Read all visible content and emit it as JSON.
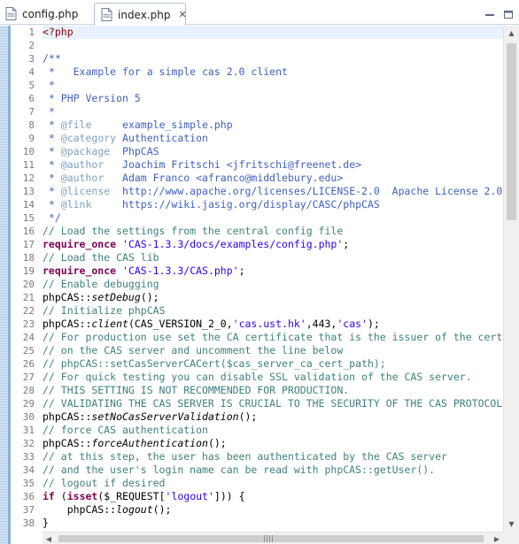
{
  "tabs": [
    {
      "label": "config.php",
      "active": false,
      "icon": "php-file-icon"
    },
    {
      "label": "index.php",
      "active": true,
      "icon": "php-file-icon",
      "close_glyph": "✕"
    }
  ],
  "window_controls": {
    "minimize_icon": "minimize-icon",
    "maximize_icon": "maximize-icon"
  },
  "colors": {
    "keyword": "#7f0055",
    "string": "#2a00ff",
    "comment": "#3f7f7f",
    "doc_comment": "#3f5fbf",
    "current_line": "#e8f2fe"
  },
  "editor": {
    "current_line": 1,
    "lines": [
      {
        "n": "1",
        "tokens": [
          {
            "t": "phptag",
            "v": "<?php"
          }
        ]
      },
      {
        "n": "2",
        "tokens": []
      },
      {
        "n": "3",
        "tokens": [
          {
            "t": "doccomment",
            "v": "/**"
          }
        ]
      },
      {
        "n": "4",
        "tokens": [
          {
            "t": "doccomment",
            "v": " *   Example for a simple cas 2.0 client"
          }
        ]
      },
      {
        "n": "5",
        "tokens": [
          {
            "t": "doccomment",
            "v": " *"
          }
        ]
      },
      {
        "n": "6",
        "tokens": [
          {
            "t": "doccomment",
            "v": " * PHP Version 5"
          }
        ]
      },
      {
        "n": "7",
        "tokens": [
          {
            "t": "doccomment",
            "v": " *"
          }
        ]
      },
      {
        "n": "8",
        "tokens": [
          {
            "t": "doccomment",
            "v": " * "
          },
          {
            "t": "tag",
            "v": "@file"
          },
          {
            "t": "doccomment",
            "v": "     example_simple.php"
          }
        ]
      },
      {
        "n": "9",
        "tokens": [
          {
            "t": "doccomment",
            "v": " * "
          },
          {
            "t": "tag",
            "v": "@category"
          },
          {
            "t": "doccomment",
            "v": " Authentication"
          }
        ]
      },
      {
        "n": "10",
        "tokens": [
          {
            "t": "doccomment",
            "v": " * "
          },
          {
            "t": "tag",
            "v": "@package"
          },
          {
            "t": "doccomment",
            "v": "  PhpCAS"
          }
        ]
      },
      {
        "n": "11",
        "tokens": [
          {
            "t": "doccomment",
            "v": " * "
          },
          {
            "t": "tag",
            "v": "@author"
          },
          {
            "t": "doccomment",
            "v": "   Joachim Fritschi <jfritschi@freenet.de>"
          }
        ]
      },
      {
        "n": "12",
        "tokens": [
          {
            "t": "doccomment",
            "v": " * "
          },
          {
            "t": "tag",
            "v": "@author"
          },
          {
            "t": "doccomment",
            "v": "   Adam Franco <afranco@middlebury.edu>"
          }
        ]
      },
      {
        "n": "13",
        "tokens": [
          {
            "t": "doccomment",
            "v": " * "
          },
          {
            "t": "tag",
            "v": "@license"
          },
          {
            "t": "doccomment",
            "v": "  http://www.apache.org/licenses/LICENSE-2.0  Apache License 2.0"
          }
        ]
      },
      {
        "n": "14",
        "tokens": [
          {
            "t": "doccomment",
            "v": " * "
          },
          {
            "t": "tag",
            "v": "@link"
          },
          {
            "t": "doccomment",
            "v": "     https://wiki.jasig.org/display/CASC/phpCAS"
          }
        ]
      },
      {
        "n": "15",
        "tokens": [
          {
            "t": "doccomment",
            "v": " */"
          }
        ]
      },
      {
        "n": "16",
        "tokens": [
          {
            "t": "comment",
            "v": "// Load the settings from the central config file"
          }
        ]
      },
      {
        "n": "17",
        "tokens": [
          {
            "t": "keyword",
            "v": "require_once"
          },
          {
            "t": "plain",
            "v": " "
          },
          {
            "t": "string",
            "v": "'CAS-1.3.3/docs/examples/config.php'"
          },
          {
            "t": "plain",
            "v": ";"
          }
        ]
      },
      {
        "n": "18",
        "tokens": [
          {
            "t": "comment",
            "v": "// Load the CAS lib"
          }
        ]
      },
      {
        "n": "19",
        "tokens": [
          {
            "t": "keyword",
            "v": "require_once"
          },
          {
            "t": "plain",
            "v": " "
          },
          {
            "t": "string",
            "v": "'CAS-1.3.3/CAS.php'"
          },
          {
            "t": "plain",
            "v": ";"
          }
        ]
      },
      {
        "n": "20",
        "tokens": [
          {
            "t": "comment",
            "v": "// Enable debugging"
          }
        ]
      },
      {
        "n": "21",
        "tokens": [
          {
            "t": "plain",
            "v": "phpCAS::"
          },
          {
            "t": "method",
            "v": "setDebug"
          },
          {
            "t": "plain",
            "v": "();"
          }
        ]
      },
      {
        "n": "22",
        "tokens": [
          {
            "t": "comment",
            "v": "// Initialize phpCAS"
          }
        ]
      },
      {
        "n": "23",
        "tokens": [
          {
            "t": "plain",
            "v": "phpCAS::"
          },
          {
            "t": "method",
            "v": "client"
          },
          {
            "t": "plain",
            "v": "(CAS_VERSION_2_0,"
          },
          {
            "t": "string",
            "v": "'cas.ust.hk'"
          },
          {
            "t": "plain",
            "v": ",443,"
          },
          {
            "t": "string",
            "v": "'cas'"
          },
          {
            "t": "plain",
            "v": ");"
          }
        ]
      },
      {
        "n": "24",
        "tokens": [
          {
            "t": "comment",
            "v": "// For production use set the CA certificate that is the issuer of the cert"
          }
        ]
      },
      {
        "n": "25",
        "tokens": [
          {
            "t": "comment",
            "v": "// on the CAS server and uncomment the line below"
          }
        ]
      },
      {
        "n": "26",
        "tokens": [
          {
            "t": "comment",
            "v": "// phpCAS::setCasServerCACert($cas_server_ca_cert_path);"
          }
        ]
      },
      {
        "n": "27",
        "tokens": [
          {
            "t": "comment",
            "v": "// For quick testing you can disable SSL validation of the CAS server."
          }
        ]
      },
      {
        "n": "28",
        "tokens": [
          {
            "t": "comment",
            "v": "// THIS SETTING IS NOT RECOMMENDED FOR PRODUCTION."
          }
        ]
      },
      {
        "n": "29",
        "tokens": [
          {
            "t": "comment",
            "v": "// VALIDATING THE CAS SERVER IS CRUCIAL TO THE SECURITY OF THE CAS PROTOCOL"
          }
        ]
      },
      {
        "n": "30",
        "tokens": [
          {
            "t": "plain",
            "v": "phpCAS::"
          },
          {
            "t": "method",
            "v": "setNoCasServerValidation"
          },
          {
            "t": "plain",
            "v": "();"
          }
        ]
      },
      {
        "n": "31",
        "tokens": [
          {
            "t": "comment",
            "v": "// force CAS authentication"
          }
        ]
      },
      {
        "n": "32",
        "tokens": [
          {
            "t": "plain",
            "v": "phpCAS::"
          },
          {
            "t": "method",
            "v": "forceAuthentication"
          },
          {
            "t": "plain",
            "v": "();"
          }
        ]
      },
      {
        "n": "33",
        "tokens": [
          {
            "t": "comment",
            "v": "// at this step, the user has been authenticated by the CAS server"
          }
        ]
      },
      {
        "n": "34",
        "tokens": [
          {
            "t": "comment",
            "v": "// and the user's login name can be read with phpCAS::getUser()."
          }
        ]
      },
      {
        "n": "35",
        "tokens": [
          {
            "t": "comment",
            "v": "// logout if desired"
          }
        ]
      },
      {
        "n": "36",
        "tokens": [
          {
            "t": "keyword",
            "v": "if"
          },
          {
            "t": "plain",
            "v": " ("
          },
          {
            "t": "keyword",
            "v": "isset"
          },
          {
            "t": "plain",
            "v": "($_REQUEST["
          },
          {
            "t": "string",
            "v": "'logout'"
          },
          {
            "t": "plain",
            "v": "])) {"
          }
        ]
      },
      {
        "n": "37",
        "tokens": [
          {
            "t": "plain",
            "v": "    phpCAS::"
          },
          {
            "t": "method",
            "v": "logout"
          },
          {
            "t": "plain",
            "v": "();"
          }
        ]
      },
      {
        "n": "38",
        "tokens": [
          {
            "t": "plain",
            "v": "}"
          }
        ]
      }
    ]
  }
}
